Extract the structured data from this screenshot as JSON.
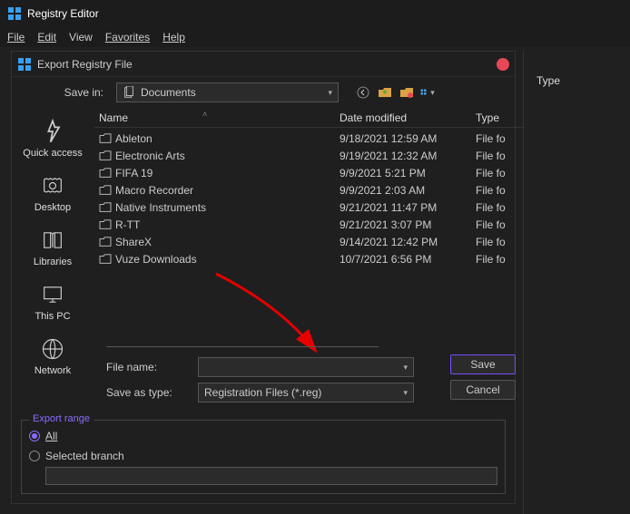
{
  "app": {
    "title": "Registry Editor"
  },
  "menu": {
    "file": "File",
    "edit": "Edit",
    "view": "View",
    "favorites": "Favorites",
    "help": "Help"
  },
  "dialog": {
    "title": "Export Registry File",
    "save_in_label": "Save in:",
    "save_in_value": "Documents",
    "toolbar_icons": {
      "back": "back-icon",
      "up": "up-folder-icon",
      "new": "new-folder-icon",
      "views": "views-icon"
    },
    "places": [
      {
        "id": "quick-access",
        "label": "Quick access"
      },
      {
        "id": "desktop",
        "label": "Desktop"
      },
      {
        "id": "libraries",
        "label": "Libraries"
      },
      {
        "id": "this-pc",
        "label": "This PC"
      },
      {
        "id": "network",
        "label": "Network"
      }
    ],
    "columns": {
      "name": "Name",
      "date": "Date modified",
      "type": "Type"
    },
    "files": [
      {
        "name": "Ableton",
        "date": "9/18/2021 12:59 AM",
        "type": "File fo"
      },
      {
        "name": "Electronic Arts",
        "date": "9/19/2021 12:32 AM",
        "type": "File fo"
      },
      {
        "name": "FIFA 19",
        "date": "9/9/2021 5:21 PM",
        "type": "File fo"
      },
      {
        "name": "Macro Recorder",
        "date": "9/9/2021 2:03 AM",
        "type": "File fo"
      },
      {
        "name": "Native Instruments",
        "date": "9/21/2021 11:47 PM",
        "type": "File fo"
      },
      {
        "name": "R-TT",
        "date": "9/21/2021 3:07 PM",
        "type": "File fo"
      },
      {
        "name": "ShareX",
        "date": "9/14/2021 12:42 PM",
        "type": "File fo"
      },
      {
        "name": "Vuze Downloads",
        "date": "10/7/2021 6:56 PM",
        "type": "File fo"
      }
    ],
    "file_name_label": "File name:",
    "file_name_value": "",
    "save_as_label": "Save as type:",
    "save_as_value": "Registration Files (*.reg)",
    "save_btn": "Save",
    "cancel_btn": "Cancel",
    "export_range": {
      "legend": "Export range",
      "all": "All",
      "selected": "Selected branch",
      "selected_value": ""
    }
  },
  "right": {
    "type_header": "Type"
  }
}
